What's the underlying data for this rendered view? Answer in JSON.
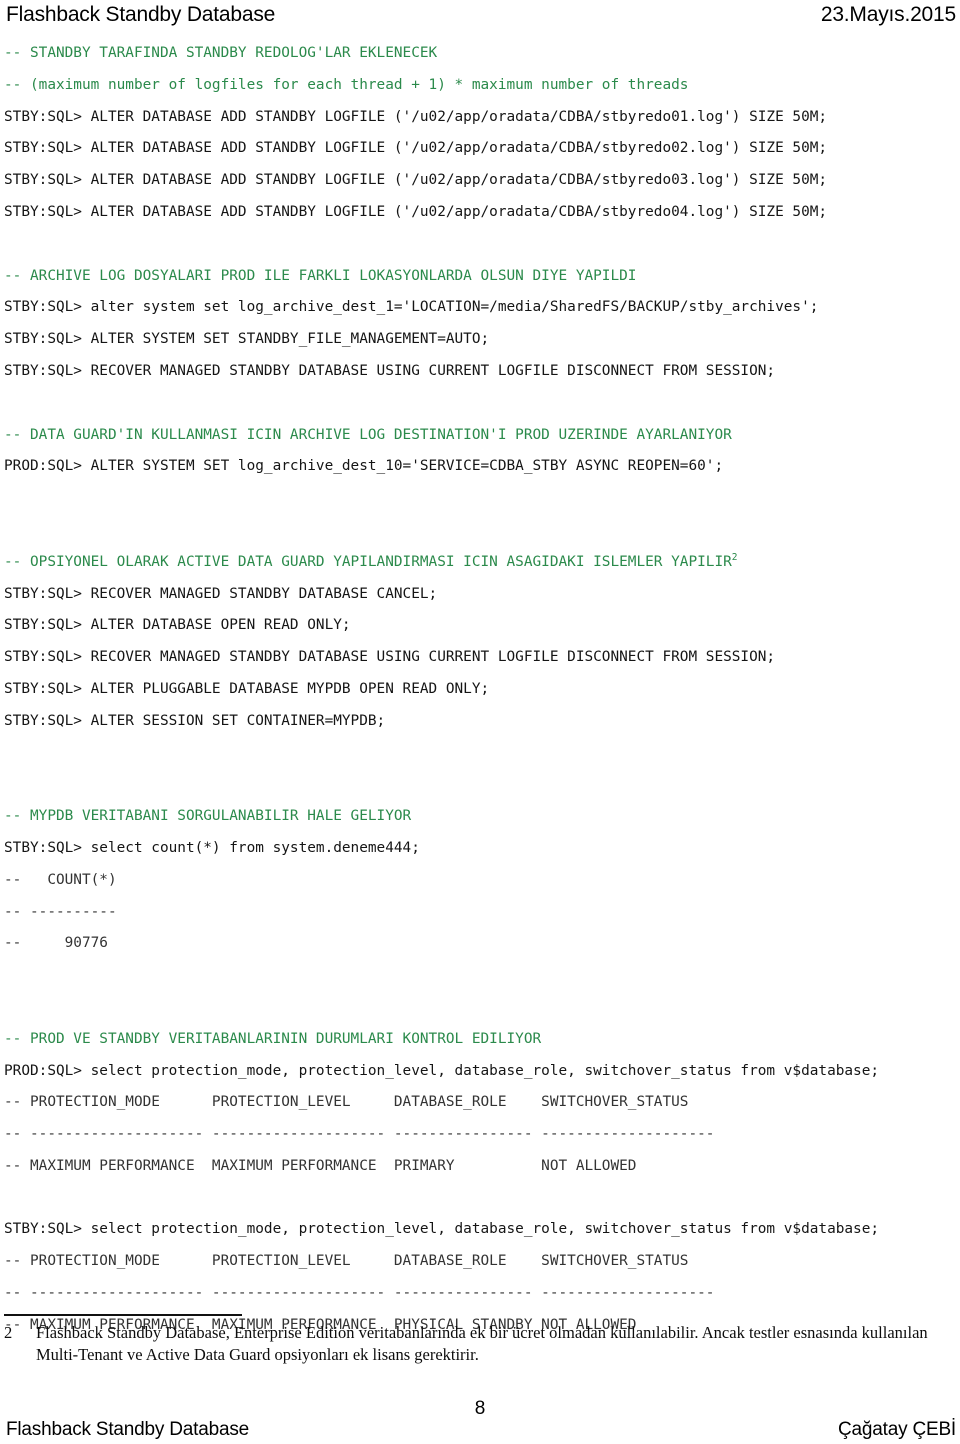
{
  "header": {
    "title": "Flashback Standby Database",
    "date": "23.Mayıs.2015"
  },
  "code_lines": [
    {
      "kind": "comment",
      "text": "-- STANDBY TARAFINDA STANDBY REDOLOG'LAR EKLENECEK"
    },
    {
      "kind": "comment",
      "text": "-- (maximum number of logfiles for each thread + 1) * maximum number of threads"
    },
    {
      "kind": "cmd",
      "text": "STBY:SQL> ALTER DATABASE ADD STANDBY LOGFILE ('/u02/app/oradata/CDBA/stbyredo01.log') SIZE 50M;"
    },
    {
      "kind": "cmd",
      "text": "STBY:SQL> ALTER DATABASE ADD STANDBY LOGFILE ('/u02/app/oradata/CDBA/stbyredo02.log') SIZE 50M;"
    },
    {
      "kind": "cmd",
      "text": "STBY:SQL> ALTER DATABASE ADD STANDBY LOGFILE ('/u02/app/oradata/CDBA/stbyredo03.log') SIZE 50M;"
    },
    {
      "kind": "cmd",
      "text": "STBY:SQL> ALTER DATABASE ADD STANDBY LOGFILE ('/u02/app/oradata/CDBA/stbyredo04.log') SIZE 50M;"
    },
    {
      "kind": "blank",
      "text": " "
    },
    {
      "kind": "comment",
      "text": "-- ARCHIVE LOG DOSYALARI PROD ILE FARKLI LOKASYONLARDA OLSUN DIYE YAPILDI"
    },
    {
      "kind": "cmd",
      "text": "STBY:SQL> alter system set log_archive_dest_1='LOCATION=/media/SharedFS/BACKUP/stby_archives';"
    },
    {
      "kind": "cmd",
      "text": "STBY:SQL> ALTER SYSTEM SET STANDBY_FILE_MANAGEMENT=AUTO;"
    },
    {
      "kind": "cmd",
      "text": "STBY:SQL> RECOVER MANAGED STANDBY DATABASE USING CURRENT LOGFILE DISCONNECT FROM SESSION;"
    },
    {
      "kind": "blank",
      "text": " "
    },
    {
      "kind": "comment",
      "text": "-- DATA GUARD'IN KULLANMASI ICIN ARCHIVE LOG DESTINATION'I PROD UZERINDE AYARLANIYOR"
    },
    {
      "kind": "cmd",
      "text": "PROD:SQL> ALTER SYSTEM SET log_archive_dest_10='SERVICE=CDBA_STBY ASYNC REOPEN=60';"
    },
    {
      "kind": "blank",
      "text": " "
    },
    {
      "kind": "blank",
      "text": " "
    },
    {
      "kind": "comment",
      "text": "-- OPSIYONEL OLARAK ACTIVE DATA GUARD YAPILANDIRMASI ICIN ASAGIDAKI ISLEMLER YAPILIR",
      "footnote_ref": "2"
    },
    {
      "kind": "cmd",
      "text": "STBY:SQL> RECOVER MANAGED STANDBY DATABASE CANCEL;"
    },
    {
      "kind": "cmd",
      "text": "STBY:SQL> ALTER DATABASE OPEN READ ONLY;"
    },
    {
      "kind": "cmd",
      "text": "STBY:SQL> RECOVER MANAGED STANDBY DATABASE USING CURRENT LOGFILE DISCONNECT FROM SESSION;"
    },
    {
      "kind": "cmd",
      "text": "STBY:SQL> ALTER PLUGGABLE DATABASE MYPDB OPEN READ ONLY;"
    },
    {
      "kind": "cmd",
      "text": "STBY:SQL> ALTER SESSION SET CONTAINER=MYPDB;"
    },
    {
      "kind": "blank",
      "text": " "
    },
    {
      "kind": "blank",
      "text": " "
    },
    {
      "kind": "comment",
      "text": "-- MYPDB VERITABANI SORGULANABILIR HALE GELIYOR"
    },
    {
      "kind": "cmd",
      "text": "STBY:SQL> select count(*) from system.deneme444;"
    },
    {
      "kind": "out",
      "text": "--   COUNT(*)"
    },
    {
      "kind": "out",
      "text": "-- ----------"
    },
    {
      "kind": "out",
      "text": "--     90776"
    },
    {
      "kind": "blank",
      "text": " "
    },
    {
      "kind": "blank",
      "text": " "
    },
    {
      "kind": "comment",
      "text": "-- PROD VE STANDBY VERITABANLARININ DURUMLARI KONTROL EDILIYOR"
    },
    {
      "kind": "cmd",
      "wrap": true,
      "text": "PROD:SQL> select protection_mode, protection_level, database_role, switchover_status from v$database;"
    },
    {
      "kind": "out",
      "text": "-- PROTECTION_MODE      PROTECTION_LEVEL     DATABASE_ROLE    SWITCHOVER_STATUS"
    },
    {
      "kind": "out",
      "text": "-- -------------------- -------------------- ---------------- --------------------"
    },
    {
      "kind": "out",
      "text": "-- MAXIMUM PERFORMANCE  MAXIMUM PERFORMANCE  PRIMARY          NOT ALLOWED"
    },
    {
      "kind": "blank",
      "text": " "
    },
    {
      "kind": "cmd",
      "wrap": true,
      "text": "STBY:SQL> select protection_mode, protection_level, database_role, switchover_status from v$database;"
    },
    {
      "kind": "out",
      "text": "-- PROTECTION_MODE      PROTECTION_LEVEL     DATABASE_ROLE    SWITCHOVER_STATUS"
    },
    {
      "kind": "out",
      "text": "-- -------------------- -------------------- ---------------- --------------------"
    },
    {
      "kind": "out",
      "text": "-- MAXIMUM PERFORMANCE  MAXIMUM PERFORMANCE  PHYSICAL STANDBY NOT ALLOWED"
    }
  ],
  "footnote": {
    "number": "2",
    "text": "Flashback Standby Database, Enterprise Edition veritabanlarında ek bir ücret olmadan kullanılabilir. Ancak testler esnasında kullanılan Multi-Tenant ve Active Data Guard opsiyonları ek lisans gerektirir."
  },
  "page_number": "8",
  "footer": {
    "title": "Flashback Standby Database",
    "author": "Çağatay ÇEBİ"
  },
  "colors": {
    "comment_green": "#2b8a4b",
    "command_black": "#151515",
    "output_gray": "#333333"
  }
}
